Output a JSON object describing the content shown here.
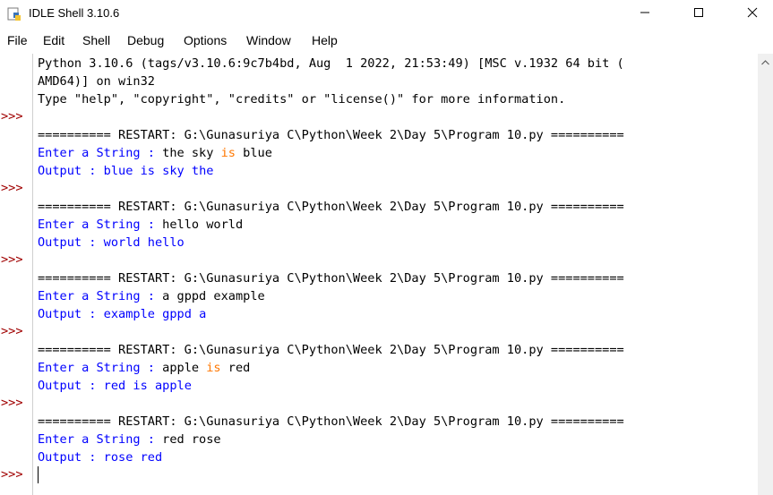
{
  "window": {
    "title": "IDLE Shell 3.10.6",
    "icons": [
      "python-idle-icon",
      "minimize-icon",
      "maximize-icon",
      "close-icon"
    ]
  },
  "menu": {
    "items": [
      "File",
      "Edit",
      "Shell",
      "Debug",
      "Options",
      "Window",
      "Help"
    ]
  },
  "shell": {
    "prompt": ">>>",
    "banner": [
      "Python 3.10.6 (tags/v3.10.6:9c7b4bd, Aug  1 2022, 21:53:49) [MSC v.1932 64 bit (",
      "AMD64)] on win32",
      "Type \"help\", \"copyright\", \"credits\" or \"license()\" for more information."
    ],
    "restart_line": "========== RESTART: G:\\Gunasuriya C\\Python\\Week 2\\Day 5\\Program 10.py ==========",
    "runs": [
      {
        "prompt_label": "Enter a String : ",
        "input": [
          "the sky ",
          "is",
          " blue"
        ],
        "output_label": "Output : ",
        "output": "blue is sky the"
      },
      {
        "prompt_label": "Enter a String : ",
        "input": [
          "hello world"
        ],
        "output_label": "Output : ",
        "output": "world hello"
      },
      {
        "prompt_label": "Enter a String : ",
        "input": [
          "a gppd example"
        ],
        "output_label": "Output : ",
        "output": "example gppd a"
      },
      {
        "prompt_label": "Enter a String : ",
        "input": [
          "apple ",
          "is",
          " red"
        ],
        "output_label": "Output : ",
        "output": "red is apple"
      },
      {
        "prompt_label": "Enter a String : ",
        "input": [
          "red rose"
        ],
        "output_label": "Output : ",
        "output": "rose red"
      }
    ],
    "colors": {
      "prompt": "#a00000",
      "program_output": "#0000ff",
      "keyword": "#ff7700",
      "text": "#000000"
    }
  }
}
